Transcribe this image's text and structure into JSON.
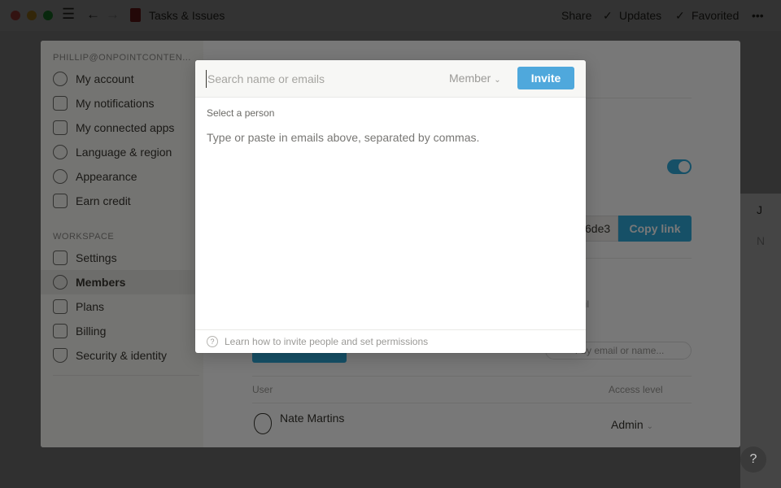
{
  "titlebar": {
    "page_title": "Tasks & Issues",
    "share": "Share",
    "updates": "Updates",
    "favorited": "Favorited",
    "more": "•••",
    "check": "✓"
  },
  "page": {
    "avatar_initial": "J",
    "new_label": "N"
  },
  "settings": {
    "account_email": "PHILLIP@ONPOINTCONTEN...",
    "account_items": [
      {
        "label": "My account",
        "icon": "avatar-icon"
      },
      {
        "label": "My notifications",
        "icon": "bell-icon"
      },
      {
        "label": "My connected apps",
        "icon": "arrow-box-icon"
      },
      {
        "label": "Language & region",
        "icon": "globe-icon"
      },
      {
        "label": "Appearance",
        "icon": "moon-icon"
      },
      {
        "label": "Earn credit",
        "icon": "gift-icon"
      }
    ],
    "workspace_header": "WORKSPACE",
    "workspace_items": [
      {
        "label": "Settings",
        "icon": "building-icon"
      },
      {
        "label": "Members",
        "icon": "people-icon",
        "active": true
      },
      {
        "label": "Plans",
        "icon": "map-icon"
      },
      {
        "label": "Billing",
        "icon": "card-icon"
      },
      {
        "label": "Security & identity",
        "icon": "shield-icon"
      }
    ],
    "main": {
      "invite_link_suffix": "6de3",
      "copy_link": "Copy link",
      "email_fragment": "ail",
      "filter_placeholder": "r by email or name...",
      "col_user": "User",
      "col_access": "Access level",
      "members": [
        {
          "name": "Nate Martins",
          "access": "Admin"
        }
      ],
      "toggle_on": true
    }
  },
  "invite_popup": {
    "search_placeholder": "Search name or emails",
    "role": "Member",
    "invite": "Invite",
    "section": "Select a person",
    "hint": "Type or paste in emails above, separated by commas.",
    "footer": "Learn how to invite people and set permissions"
  },
  "help": "?",
  "colors": {
    "accent": "#2eaadc",
    "invite_button": "#4fa8dc"
  }
}
